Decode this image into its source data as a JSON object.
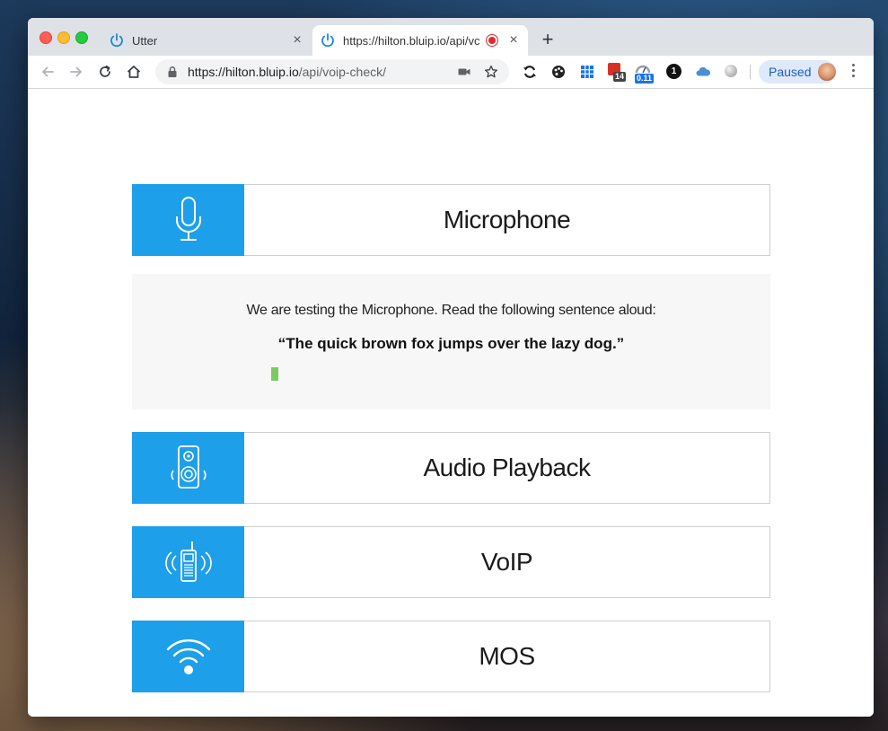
{
  "browser": {
    "tabs": [
      {
        "title": "Utter",
        "close": "×"
      },
      {
        "title": "https://hilton.bluip.io/api/vc",
        "close": "×"
      }
    ],
    "new_tab": "+",
    "url_host": "https://hilton.bluip.io",
    "url_path": "/api/voip-check/",
    "profile_label": "Paused",
    "extension_badges": {
      "red_counter": "14",
      "speed_counter": "0.11",
      "dark_circle": "1"
    }
  },
  "page": {
    "accent_color": "#1e9fe9",
    "microphone": {
      "label": "Microphone",
      "instruction": "We are testing the Microphone. Read the following sentence aloud:",
      "sentence": "“The quick brown fox jumps over the lazy dog.”",
      "level_percent": 2
    },
    "audio_playback": {
      "label": "Audio Playback"
    },
    "voip": {
      "label": "VoIP"
    },
    "mos": {
      "label": "MOS"
    }
  }
}
